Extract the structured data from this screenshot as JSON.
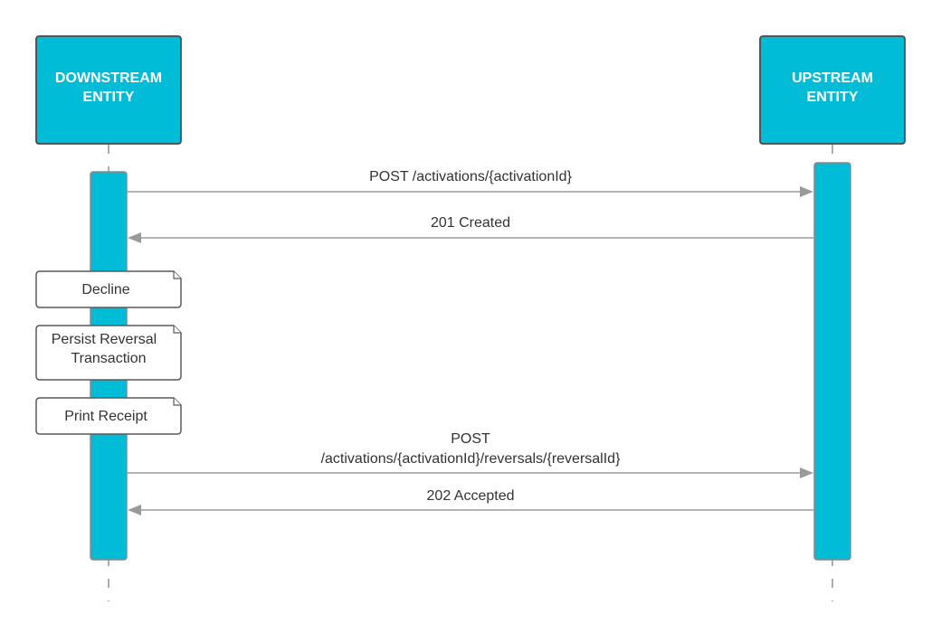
{
  "actors": {
    "downstream": {
      "line1": "DOWNSTREAM",
      "line2": "ENTITY"
    },
    "upstream": {
      "line1": "UPSTREAM",
      "line2": "ENTITY"
    }
  },
  "messages": [
    {
      "lines": [
        "POST /activations/{activationId}"
      ],
      "direction": "right"
    },
    {
      "lines": [
        "201 Created"
      ],
      "direction": "left"
    },
    {
      "lines": [
        "POST",
        "/activations/{activationId}/reversals/{reversalId}"
      ],
      "direction": "right"
    },
    {
      "lines": [
        "202 Accepted"
      ],
      "direction": "left"
    }
  ],
  "notes": [
    {
      "lines": [
        "Decline"
      ]
    },
    {
      "lines": [
        "Persist Reversal",
        "Transaction"
      ]
    },
    {
      "lines": [
        "Print Receipt"
      ]
    }
  ],
  "colors": {
    "actor_fill": "#00bcd6",
    "line": "#9a9a9a",
    "note_border": "#5a5a5a"
  }
}
